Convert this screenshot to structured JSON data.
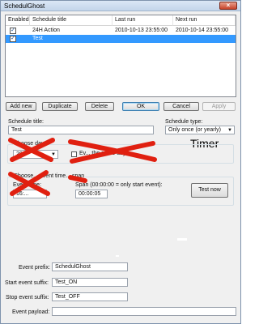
{
  "window": {
    "title": "SchedulGhost",
    "close_glyph": "×"
  },
  "list": {
    "columns": [
      "Enabled",
      "Schedule title",
      "Last run",
      "Next run"
    ],
    "rows": [
      {
        "enabled": true,
        "title": "24H Action",
        "last_run": "2010-10-13 23:55:00",
        "next_run": "2010-10-14 23:55:00",
        "selected": false
      },
      {
        "enabled": true,
        "title": "Test",
        "last_run": "",
        "next_run": "",
        "selected": true
      }
    ],
    "check_glyph": "✓"
  },
  "toolbar": {
    "add_new": "Add new",
    "duplicate": "Duplicate",
    "delete": "Delete",
    "ok": "OK",
    "cancel": "Cancel",
    "apply": "Apply"
  },
  "schedule": {
    "title_label": "Schedule title:",
    "title_value": "Test",
    "type_label": "Schedule type:",
    "type_value": "Only once (or yearly)",
    "annotation": "Timer",
    "choose_day_caption": "Choose day",
    "date_value": "20",
    "same_day_label": "Ev... the same day",
    "event_time_caption": "Choose... event time... span",
    "event_time_label": "Event time:",
    "event_time_value": "16:...",
    "span_label": "Span (00:00:00 = only start event):",
    "span_value": "00:00:05",
    "test_now": "Test now"
  },
  "events": {
    "prefix_label": "Event prefix:",
    "prefix_value": "SchedulGhost",
    "start_label": "Start event suffix:",
    "start_value": "Test_ON",
    "stop_label": "Stop event suffix:",
    "stop_value": "Test_OFF",
    "payload_label": "Event payload:",
    "payload_value": ""
  },
  "colors": {
    "selection": "#3399ff",
    "scribble": "#e02010"
  }
}
